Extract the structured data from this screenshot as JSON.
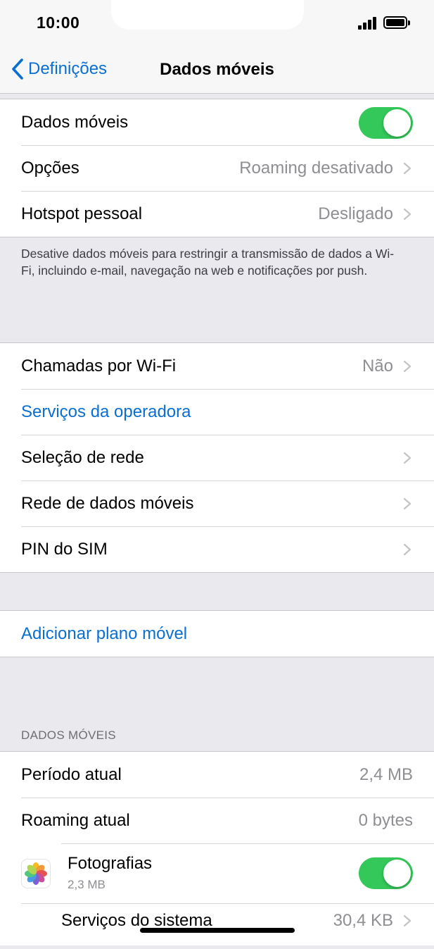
{
  "status": {
    "time": "10:00"
  },
  "nav": {
    "back_label": "Definições",
    "title": "Dados móveis"
  },
  "group1": {
    "cellular_data": {
      "label": "Dados móveis",
      "on": true
    },
    "options": {
      "label": "Opções",
      "value": "Roaming desativado"
    },
    "hotspot": {
      "label": "Hotspot pessoal",
      "value": "Desligado"
    }
  },
  "group1_footer": "Desative dados móveis para restringir a transmissão de dados a Wi-Fi, incluindo e-mail, navegação na web e notificações por push.",
  "group2": {
    "wifi_calls": {
      "label": "Chamadas por Wi-Fi",
      "value": "Não"
    },
    "carrier_services": {
      "label": "Serviços da operadora"
    },
    "network_selection": {
      "label": "Seleção de rede"
    },
    "cellular_network": {
      "label": "Rede de dados móveis"
    },
    "sim_pin": {
      "label": "PIN do SIM"
    }
  },
  "group3": {
    "add_plan": {
      "label": "Adicionar plano móvel"
    }
  },
  "usage": {
    "header": "DADOS MÓVEIS",
    "current_period": {
      "label": "Período atual",
      "value": "2,4 MB"
    },
    "current_roaming": {
      "label": "Roaming atual",
      "value": "0 bytes"
    },
    "photos": {
      "label": "Fotografias",
      "size": "2,3 MB",
      "on": true,
      "icon": "photos-icon"
    },
    "system_services": {
      "label": "Serviços do sistema",
      "value": "30,4 KB"
    }
  },
  "colors": {
    "accent": "#0a6fd1",
    "toggle_on": "#34c759",
    "background": "#e9e9ee"
  }
}
